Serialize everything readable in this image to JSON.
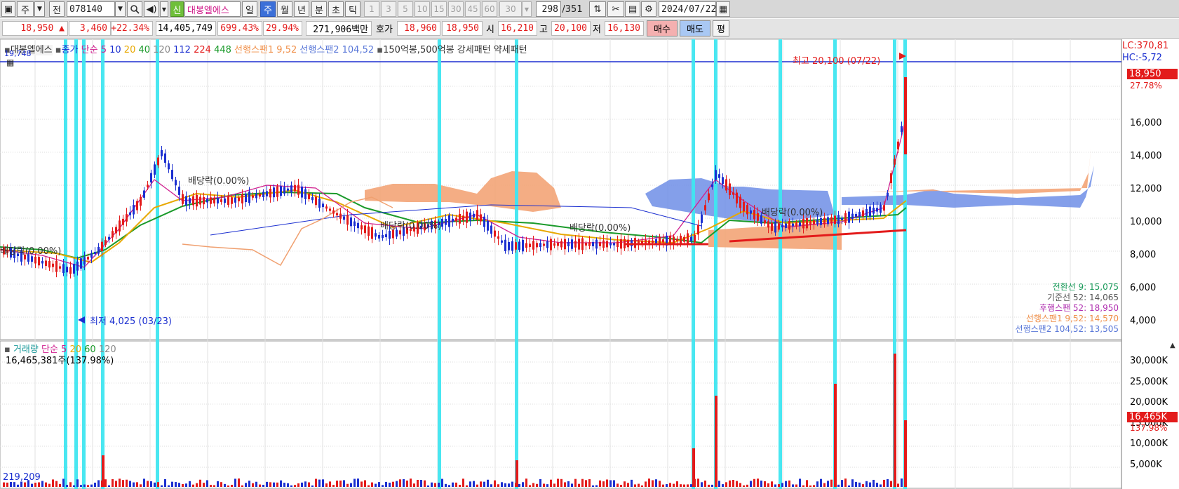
{
  "toolbar": {
    "period_select": "주",
    "prev_label": "전",
    "code_value": "078140",
    "new_badge": "신",
    "stock_name": "대봉엘에스",
    "period_tabs": [
      "일",
      "주",
      "월",
      "년",
      "분",
      "초",
      "틱"
    ],
    "active_tab": "주",
    "interval_buttons": [
      "1",
      "3",
      "5",
      "10",
      "15",
      "30",
      "45",
      "60"
    ],
    "interval_select": "30",
    "page_current": "298",
    "page_total": "/351",
    "date_value": "2024/07/22"
  },
  "quote": {
    "price": "18,950 ▲",
    "change": "3,460",
    "change_pct": "+22.34%",
    "volume": "14,405,749",
    "volume_ratio": "699.43%",
    "turnover": "29.94%",
    "amount": "271,906백만",
    "hoga_label": "호가",
    "ask": "18,960",
    "bid": "18,950",
    "open_label": "시",
    "open": "16,210",
    "high_label": "고",
    "high": "20,100",
    "low_label": "저",
    "low": "16,130",
    "buy_label": "매수",
    "sell_label": "매도",
    "eval_label": "평"
  },
  "price_panel": {
    "legend": {
      "name": "대봉엘에스",
      "close": "종가",
      "ma_label": "단순 5",
      "ma_items": [
        "10",
        "20",
        "40",
        "120",
        "112",
        "224",
        "448"
      ],
      "span1": "선행스팬1 9,52",
      "span2": "선행스팬2 104,52",
      "pattern": "150억봉,500억봉 강세패턴",
      "weak": "약세패턴"
    },
    "top_left_value": "19,748",
    "lc_label": "LC:370,81",
    "hc_label": "HC:-5,72",
    "current_price_tag": "18,950",
    "current_pct_tag": "27.78%",
    "y_ticks": [
      "16,000",
      "14,000",
      "12,000",
      "10,000",
      "8,000",
      "6,000",
      "4,000"
    ],
    "high_annotation": "최고 20,100 (07/22)",
    "low_annotation": "최저 4,025 (03/23)",
    "dividend_labels": [
      "배당락(0.00%)",
      "배당락(0.00%)",
      "배당락(0.00%)",
      "배당락(0.00%)",
      "배당락(0.00%)"
    ],
    "ichimoku": [
      {
        "label": "전환선 9: 15,075",
        "color": "#1a9a5a"
      },
      {
        "label": "기준선 52: 14,065",
        "color": "#555555"
      },
      {
        "label": "후행스팬 52: 18,950",
        "color": "#b030b0"
      },
      {
        "label": "선행스팬1 9,52: 14,570",
        "color": "#f0904a"
      },
      {
        "label": "선행스팬2 104,52: 13,505",
        "color": "#5a78d8"
      }
    ]
  },
  "volume_panel": {
    "legend": {
      "name": "거래량",
      "ma_label": "단순 5",
      "ma_items": [
        "20",
        "60",
        "120"
      ]
    },
    "current_volume": "16,465,381주(137.98%)",
    "min_value": "219,209",
    "current_tag": "16,465K",
    "current_pct_tag": "137.98%",
    "y_ticks": [
      "30,000K",
      "25,000K",
      "20,000K",
      "15,000K",
      "10,000K",
      "5,000K"
    ]
  },
  "colors": {
    "up": "#e31b1b",
    "down": "#1b2fd0",
    "highlight": "#3fe6f0",
    "cloud_orange": "#f3a477",
    "cloud_blue": "#6f8ee6",
    "ma5": "#d0208f",
    "ma20": "#e8a800",
    "ma40": "#1a9a2a"
  }
}
